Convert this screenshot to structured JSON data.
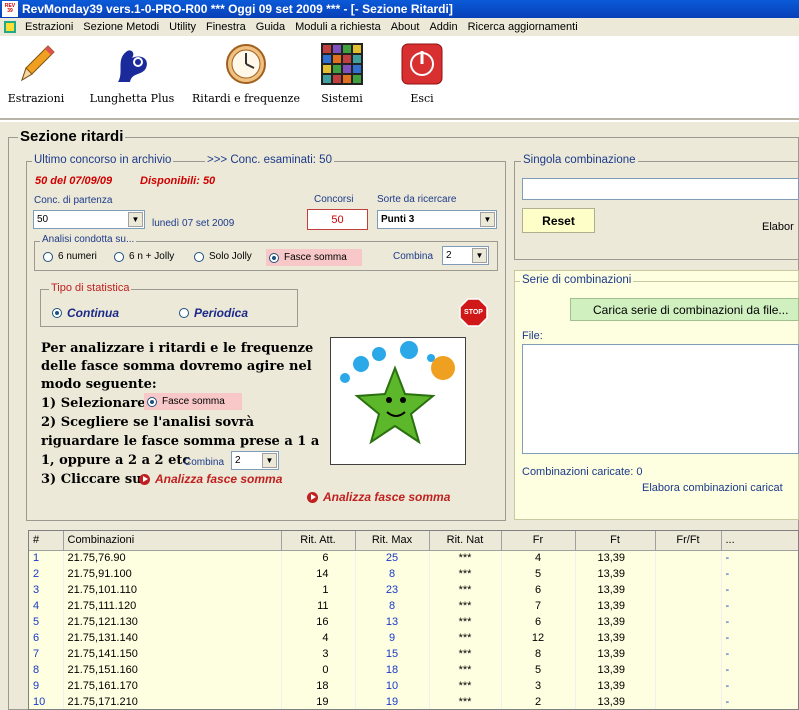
{
  "window": {
    "title": "RevMonday39 vers.1-0-PRO-R00  ***  Oggi 09 set 2009  ***  - [- Sezione Ritardi]"
  },
  "menu": [
    "Estrazioni",
    "Sezione Metodi",
    "Utility",
    "Finestra",
    "Guida",
    "Moduli a richiesta",
    "About",
    "Addin",
    "Ricerca aggiornamenti"
  ],
  "toolbar": [
    {
      "label": "Estrazioni",
      "icon": "pencil-icon"
    },
    {
      "label": "Lunghetta Plus",
      "icon": "lottery-hand-icon"
    },
    {
      "label": "Ritardi e frequenze",
      "icon": "clock-icon"
    },
    {
      "label": "Sistemi",
      "icon": "grid-icon"
    },
    {
      "label": "Esci",
      "icon": "power-icon"
    }
  ],
  "section_title": "Sezione ritardi",
  "archivio": {
    "label": "Ultimo concorso in archivio",
    "esaminati": ">>> Conc. esaminati: 50",
    "last": "50 del 07/09/09",
    "disponibili": "Disponibili: 50"
  },
  "fields": {
    "conc_partenza_label": "Conc. di partenza",
    "conc_partenza_value": "50",
    "conc_date": "lunedì 07 set 2009",
    "concorsi_label": "Concorsi",
    "concorsi_value": "50",
    "sorte_label": "Sorte da ricercare",
    "sorte_value": "Punti 3"
  },
  "analisi": {
    "label": "Analisi condotta su...",
    "options": [
      "6 numeri",
      "6 n + Jolly",
      "Solo Jolly",
      "Fasce somma"
    ],
    "combina_label": "Combina",
    "combina_value": "2"
  },
  "tipo": {
    "label": "Tipo di statistica",
    "continua": "Continua",
    "periodica": "Periodica"
  },
  "stop_label": "STOP",
  "instructions": {
    "line1": "Per analizzare i ritardi e le frequenze",
    "line2": "delle fasce somma dovremo agire nel",
    "line3": "modo seguente:",
    "line4": "1) Selezionare",
    "chip": "Fasce somma",
    "line5": "2) Scegliere se l'analisi sovrà",
    "line6": "riguardare le fasce somma prese a 1 a",
    "line7": "1, oppure a 2 a 2 etc",
    "combina_label": "Combina",
    "combina_value": "2",
    "line8": "3) Cliccare su",
    "link": "Analizza fasce somma"
  },
  "analizza_button": "Analizza fasce somma",
  "singola": {
    "label": "Singola combinazione",
    "input": "",
    "reset": "Reset",
    "elabora": "Elabor"
  },
  "serie": {
    "label": "Serie di combinazioni",
    "carica": "Carica serie di combinazioni da file...",
    "file_label": "File:",
    "caricate": "Combinazioni caricate: 0",
    "elabora": "Elabora combinazioni caricat"
  },
  "table": {
    "headers": [
      "#",
      "Combinazioni",
      "Rit. Att.",
      "Rit. Max",
      "Rit. Nat",
      "Fr",
      "Ft",
      "Fr/Ft",
      "..."
    ],
    "rows": [
      [
        "1",
        "21.75,76.90",
        "6",
        "25",
        "***",
        "4",
        "13,39",
        "",
        "-"
      ],
      [
        "2",
        "21.75,91.100",
        "14",
        "8",
        "***",
        "5",
        "13,39",
        "",
        "-"
      ],
      [
        "3",
        "21.75,101.110",
        "1",
        "23",
        "***",
        "6",
        "13,39",
        "",
        "-"
      ],
      [
        "4",
        "21.75,111.120",
        "11",
        "8",
        "***",
        "7",
        "13,39",
        "",
        "-"
      ],
      [
        "5",
        "21.75,121.130",
        "16",
        "13",
        "***",
        "6",
        "13,39",
        "",
        "-"
      ],
      [
        "6",
        "21.75,131.140",
        "4",
        "9",
        "***",
        "12",
        "13,39",
        "",
        "-"
      ],
      [
        "7",
        "21.75,141.150",
        "3",
        "15",
        "***",
        "8",
        "13,39",
        "",
        "-"
      ],
      [
        "8",
        "21.75,151.160",
        "0",
        "18",
        "***",
        "5",
        "13,39",
        "",
        "-"
      ],
      [
        "9",
        "21.75,161.170",
        "18",
        "10",
        "***",
        "3",
        "13,39",
        "",
        "-"
      ],
      [
        "10",
        "21.75,171.210",
        "19",
        "19",
        "***",
        "2",
        "13,39",
        "",
        "-"
      ]
    ]
  }
}
